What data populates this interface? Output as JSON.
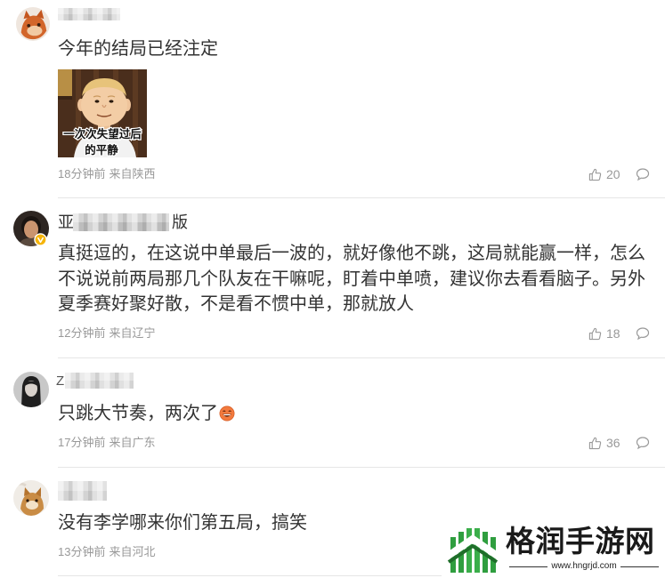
{
  "comments": [
    {
      "lines": [
        "今年的结局已经注定"
      ],
      "image_caption": [
        "一次次失望过后",
        "的平静"
      ],
      "time": "18分钟前",
      "location": "来自陕西",
      "likes": "20"
    },
    {
      "name_prefix": "亚",
      "name_suffix": "版",
      "verified": true,
      "lines": [
        "真挺逗的，在这说中单最后一波的，就好像他不跳，这局就能赢一样，怎么",
        "不说说前两局那几个队友在干嘛呢，盯着中单喷，建议你去看看脑子。另外",
        "夏季赛好聚好散，不是看不惯中单，那就放人"
      ],
      "time": "12分钟前",
      "location": "来自辽宁",
      "likes": "18"
    },
    {
      "name_prefix": "Z",
      "lines": [
        "只跳大节奏，两次了"
      ],
      "emoji": "laughing-face",
      "time": "17分钟前",
      "location": "来自广东",
      "likes": "36"
    },
    {
      "lines": [
        "没有李学哪来你们第五局，搞笑"
      ],
      "time": "13分钟前",
      "location": "来自河北"
    }
  ],
  "icons": {
    "like": "thumbs-up-icon",
    "reply": "comment-bubble-icon",
    "verified": "verified-badge-icon"
  },
  "watermark": {
    "name": "格润手游网",
    "url": "www.hngrjd.com"
  },
  "colors": {
    "text": "#333333",
    "meta": "#999999",
    "divider": "#e6e6e6",
    "verified": "#f5b40a",
    "watermark_green": "#2f9e3f"
  }
}
